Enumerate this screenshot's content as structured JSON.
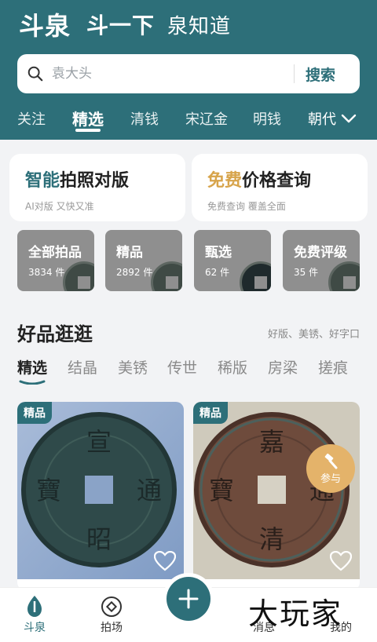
{
  "brand": {
    "name": "斗泉",
    "slogan_a": "斗一下",
    "slogan_b": "泉知道"
  },
  "search": {
    "placeholder": "袁大头",
    "button": "搜索"
  },
  "tabs": [
    {
      "label": "关注"
    },
    {
      "label": "精选",
      "active": true
    },
    {
      "label": "清钱"
    },
    {
      "label": "宋辽金"
    },
    {
      "label": "明钱"
    }
  ],
  "tab_more": "朝代",
  "promos": [
    {
      "title_hl": "智能",
      "title_rest": "拍照对版",
      "sub": "AI对版 又快又准"
    },
    {
      "title_hl": "免费",
      "title_rest": "价格查询",
      "sub": "免费查询 覆盖全面"
    }
  ],
  "categories": [
    {
      "title": "全部拍品",
      "count": "3834 件"
    },
    {
      "title": "精品",
      "count": "2892 件"
    },
    {
      "title": "甄选",
      "count": "62 件"
    },
    {
      "title": "免费评级",
      "count": "35 件"
    }
  ],
  "section": {
    "title": "好品逛逛",
    "subtitle": "好版、美锈、好字口"
  },
  "filter_tabs": [
    {
      "label": "精选",
      "active": true
    },
    {
      "label": "结晶"
    },
    {
      "label": "美锈"
    },
    {
      "label": "传世"
    },
    {
      "label": "稀版"
    },
    {
      "label": "房梁"
    },
    {
      "label": "搓痕"
    }
  ],
  "cards": [
    {
      "badge": "精品",
      "coin_chars": [
        "宣",
        "通",
        "昭",
        "寶"
      ],
      "color": "#8fa6c9"
    },
    {
      "badge": "精品",
      "coin_chars": [
        "嘉",
        "通",
        "清",
        "寶"
      ],
      "bid_label": "参与",
      "color": "#c9c3b3"
    }
  ],
  "bottom_nav": [
    {
      "label": "斗泉",
      "active": true
    },
    {
      "label": "拍场"
    },
    {
      "label": "消息"
    },
    {
      "label": "我的"
    }
  ],
  "watermark": "大玩家",
  "colors": {
    "primary": "#2d6f79",
    "accent_gold": "#d7a44b",
    "background": "#f2f3f5"
  }
}
